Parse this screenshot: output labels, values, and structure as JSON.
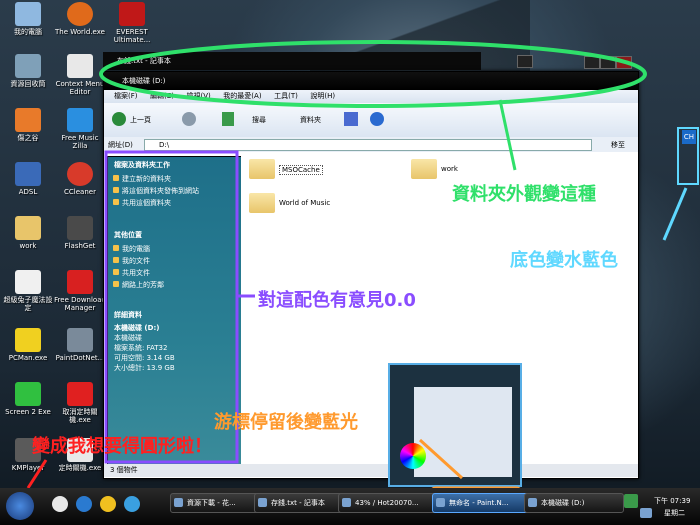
{
  "desktop_icons": [
    {
      "label": "我的電腦",
      "icon": "computer-icon"
    },
    {
      "label": "The World.exe",
      "icon": "browser-icon"
    },
    {
      "label": "EVEREST Ultimate...",
      "icon": "everest-icon"
    },
    {
      "label": "資源回收筒",
      "icon": "recycle-bin-icon"
    },
    {
      "label": "Context Menu Editor",
      "icon": "context-menu-icon"
    },
    {
      "label": "傷之谷",
      "icon": "game-icon"
    },
    {
      "label": "Free Music Zilla",
      "icon": "music-icon"
    },
    {
      "label": "ADSL",
      "icon": "network-icon"
    },
    {
      "label": "CCleaner",
      "icon": "ccleaner-icon"
    },
    {
      "label": "work",
      "icon": "folder-icon"
    },
    {
      "label": "FlashGet",
      "icon": "flashget-icon"
    },
    {
      "label": "超級兔子魔法設定",
      "icon": "rabbit-icon"
    },
    {
      "label": "Free Download Manager",
      "icon": "download-icon"
    },
    {
      "label": "PCMan.exe",
      "icon": "pcman-icon"
    },
    {
      "label": "PaintDotNet...",
      "icon": "paint-icon"
    },
    {
      "label": "Screen 2 Exe",
      "icon": "screen-icon"
    },
    {
      "label": "取消定時關機.exe",
      "icon": "shutdown-icon"
    },
    {
      "label": "KMPlayer",
      "icon": "kmplayer-icon"
    },
    {
      "label": "定時關機.exe",
      "icon": "timer-icon"
    }
  ],
  "notepad": {
    "title": "存錢.txt - 記事本"
  },
  "explorer": {
    "title": "本機磁碟 (D:)",
    "menu": [
      "檔案(F)",
      "編輯(E)",
      "檢視(V)",
      "我的最愛(A)",
      "工具(T)",
      "說明(H)"
    ],
    "toolbar": {
      "back": "上一頁",
      "search": "搜尋",
      "folders": "資料夾"
    },
    "address_label": "網址(D)",
    "address_value": "D:\\",
    "go_label": "移至",
    "tasks_title": "檔案及資料夾工作",
    "tasks": [
      "建立新的資料夾",
      "將這個資料夾發佈到網站",
      "共用這個資料夾"
    ],
    "other_title": "其他位置",
    "other": [
      "我的電腦",
      "我的文件",
      "共用文件",
      "網路上的芳鄰"
    ],
    "details_title": "詳細資料",
    "details": [
      "本機磁碟 (D:)",
      "本機磁碟",
      "檔案系統: FAT32",
      "可用空間: 3.14 GB",
      "大小總計: 13.9 GB"
    ],
    "files": [
      "MSOCache",
      "work",
      "World of Music"
    ],
    "status": "3 個物件"
  },
  "annotations": {
    "a1": "資料夾外觀變這種",
    "a2": "底色變水藍色",
    "a3": "對這配色有意見0.0",
    "a4": "游標停留後變藍光",
    "a5": "變成我想要得圓形啦！"
  },
  "taskbar": {
    "tasks": [
      "資源下載 - 花...",
      "存錢.txt - 記事本",
      "43% / Hot20070...",
      "無命名 - Paint.N...",
      "本機磁碟 (D:)"
    ],
    "clock_time": "下午 07:39",
    "clock_day": "星期二",
    "lang": "CH"
  },
  "colors": {
    "annotation_green": "#2fe06a",
    "annotation_cyan": "#5fd8ff",
    "annotation_purple": "#8a4dff",
    "annotation_orange": "#ff9a2e",
    "annotation_red": "#ff2020"
  }
}
